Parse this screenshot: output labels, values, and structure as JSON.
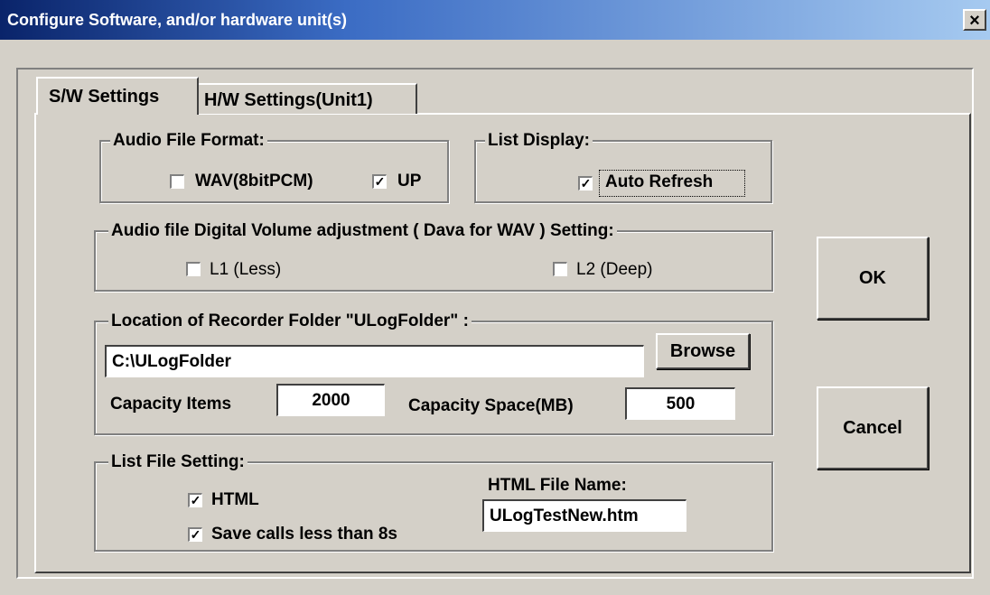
{
  "window": {
    "title": "Configure Software, and/or hardware unit(s)",
    "close_glyph": "×"
  },
  "tabs": [
    {
      "label": "S/W Settings",
      "active": true
    },
    {
      "label": "H/W Settings(Unit1)",
      "active": false
    }
  ],
  "audio_format": {
    "legend": "Audio File Format:",
    "options": [
      {
        "label": "WAV(8bitPCM)",
        "checked": false
      },
      {
        "label": "UP",
        "checked": true
      }
    ]
  },
  "list_display": {
    "legend": "List Display:",
    "auto_refresh": {
      "label": "Auto Refresh",
      "checked": true
    }
  },
  "volume": {
    "legend": "Audio file Digital Volume adjustment ( Dava for WAV ) Setting:",
    "options": [
      {
        "label": "L1 (Less)",
        "checked": false
      },
      {
        "label": "L2 (Deep)",
        "checked": false
      }
    ]
  },
  "location": {
    "legend": "Location of Recorder Folder \"ULogFolder\" :",
    "path_value": "C:\\ULogFolder",
    "browse_label": "Browse",
    "capacity_items_label": "Capacity Items",
    "capacity_items_value": "2000",
    "capacity_space_label": "Capacity Space(MB)",
    "capacity_space_value": "500"
  },
  "list_file": {
    "legend": "List File Setting:",
    "html": {
      "label": "HTML",
      "checked": true
    },
    "save_short": {
      "label": "Save calls less than 8s",
      "checked": true
    },
    "html_file_name_label": "HTML File Name:",
    "html_file_name_value": "ULogTestNew.htm"
  },
  "buttons": {
    "ok": "OK",
    "cancel": "Cancel"
  },
  "icons": {
    "check_glyph": "✓"
  },
  "colors": {
    "title_gradient_start": "#0a246a",
    "title_gradient_end": "#a6caf0",
    "face": "#d4d0c8"
  }
}
